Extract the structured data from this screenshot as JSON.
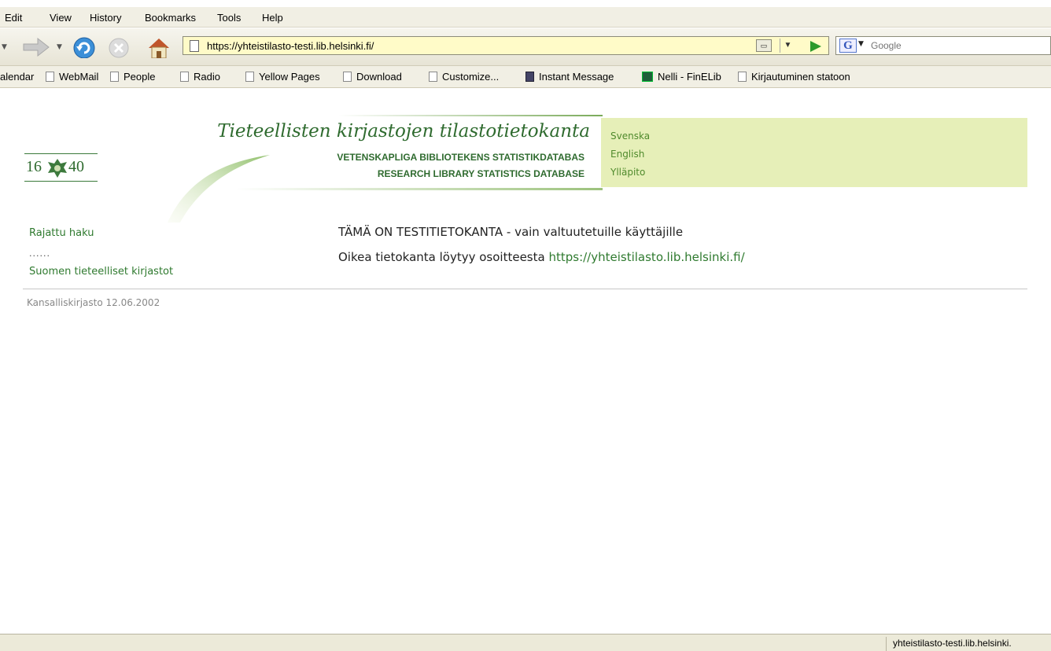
{
  "menu": [
    "Edit",
    "View",
    "History",
    "Bookmarks",
    "Tools",
    "Help"
  ],
  "toolbar": {
    "url": "https://yhteistilasto-testi.lib.helsinki.fi/",
    "search_placeholder": "Google"
  },
  "bookmarks": [
    "alendar",
    "WebMail",
    "People",
    "Radio",
    "Yellow Pages",
    "Download",
    "Customize...",
    "Instant Message",
    "Nelli - FinELib",
    "Kirjautuminen statoon"
  ],
  "header": {
    "logo_year_left": "16",
    "logo_year_right": "40",
    "title": "Tieteellisten kirjastojen tilastotietokanta",
    "subtitle_sv": "VETENSKAPLIGA BIBLIOTEKENS STATISTIKDATABAS",
    "subtitle_en": "RESEARCH LIBRARY STATISTICS DATABASE",
    "links": [
      "Svenska",
      "English",
      "Ylläpito"
    ]
  },
  "nav": {
    "item1": "Rajattu haku",
    "separator": "......",
    "item2": "Suomen tieteelliset kirjastot"
  },
  "main": {
    "notice": "TÄMÄ ON TESTITIETOKANTA - vain valtuutetuille käyttäjille",
    "redirect_text": "Oikea tietokanta löytyy osoitteesta",
    "redirect_link": "https://yhteistilasto.lib.helsinki.fi/"
  },
  "footer": {
    "text": "Kansalliskirjasto 12.06.2002"
  },
  "status": {
    "text": "yhteistilasto-testi.lib.helsinki."
  }
}
